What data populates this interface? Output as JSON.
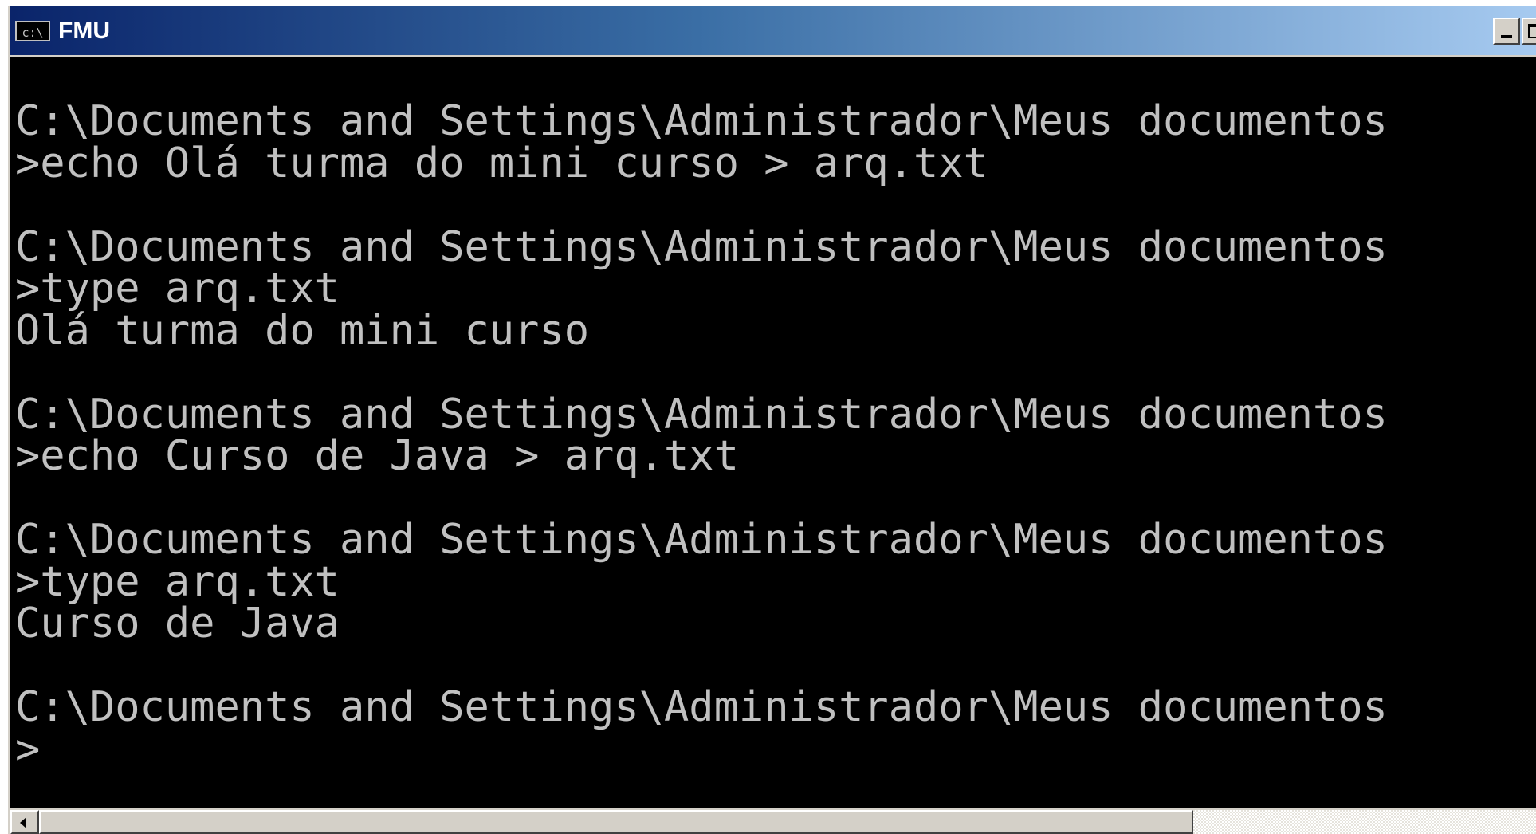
{
  "window": {
    "title": "FMU",
    "icon_label": "c:\\",
    "icon": "console-icon"
  },
  "console": {
    "lines": [
      "C:\\Documents and Settings\\Administrador\\Meus documentos",
      ">echo Olá turma do mini curso > arq.txt",
      "",
      "C:\\Documents and Settings\\Administrador\\Meus documentos",
      ">type arq.txt",
      "Olá turma do mini curso",
      "",
      "C:\\Documents and Settings\\Administrador\\Meus documentos",
      ">echo Curso de Java > arq.txt",
      "",
      "C:\\Documents and Settings\\Administrador\\Meus documentos",
      ">type arq.txt",
      "Curso de Java",
      "",
      "C:\\Documents and Settings\\Administrador\\Meus documentos",
      ">"
    ]
  },
  "scrollbar": {
    "position": 0
  },
  "colors": {
    "console_background": "#000000",
    "console_text": "#c0c0c0",
    "title_gradient_start": "#0a246a",
    "title_gradient_end": "#a6caf0"
  }
}
